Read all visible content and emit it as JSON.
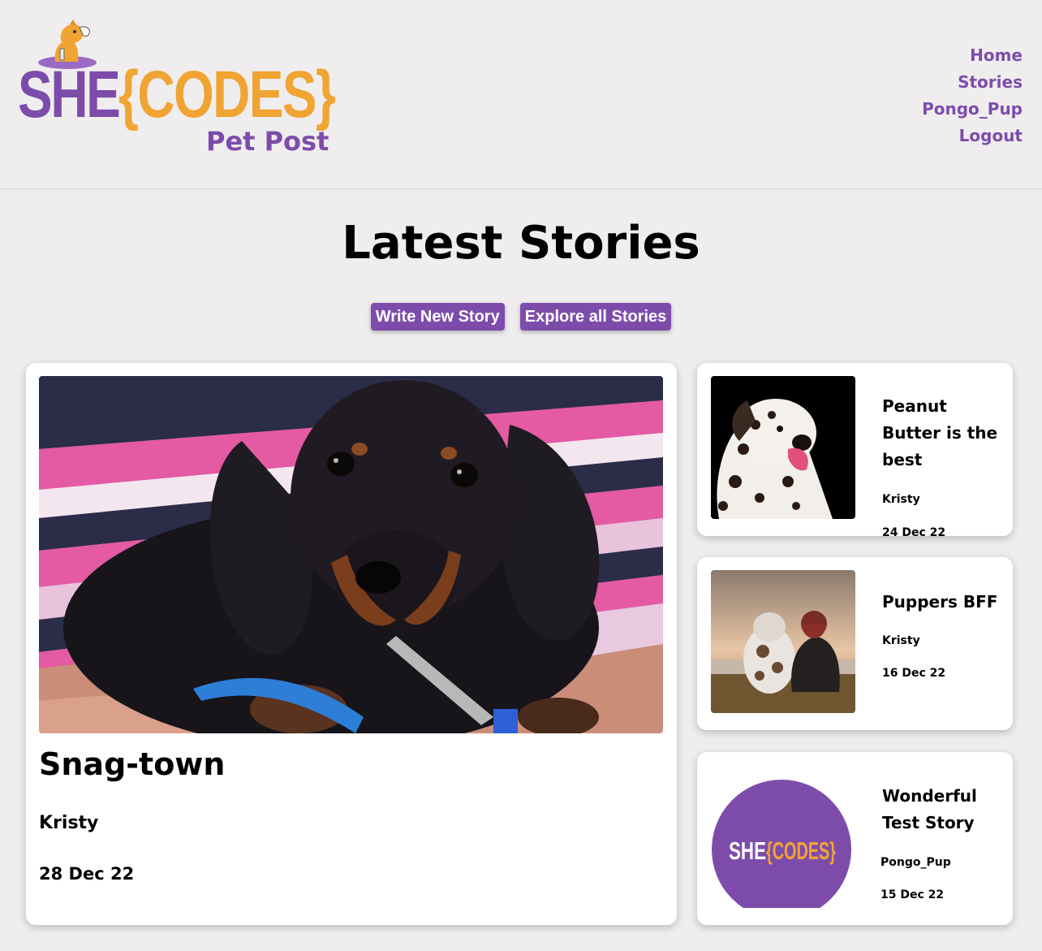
{
  "brand": {
    "logo_main_left": "SHE",
    "logo_main_right": "{CODES}",
    "logo_sub": "Pet Post",
    "colors": {
      "purple": "#7d4cab",
      "orange": "#f0a432"
    }
  },
  "nav": {
    "items": [
      {
        "label": "Home"
      },
      {
        "label": "Stories"
      },
      {
        "label": "Pongo_Pup"
      },
      {
        "label": "Logout"
      }
    ]
  },
  "page": {
    "title": "Latest Stories"
  },
  "actions": {
    "write_label": "Write New Story",
    "explore_label": "Explore all Stories"
  },
  "featured": {
    "title": "Snag-town",
    "author": "Kristy",
    "date": "28 Dec 22",
    "image": "dachshund-puppy-photo"
  },
  "side_stories": [
    {
      "title": "Peanut Butter is the best",
      "author": "Kristy",
      "date": "24 Dec 22",
      "image": "dalmatian-photo"
    },
    {
      "title": "Puppers BFF",
      "author": "Kristy",
      "date": "16 Dec 22",
      "image": "dog-and-person-sunset-photo"
    },
    {
      "title": "Wonderful Test Story",
      "author": "Pongo_Pup",
      "date": "15 Dec 22",
      "image": "shecodes-circle-logo",
      "image_text_left": "SHE",
      "image_text_right": "{CODES}"
    }
  ]
}
